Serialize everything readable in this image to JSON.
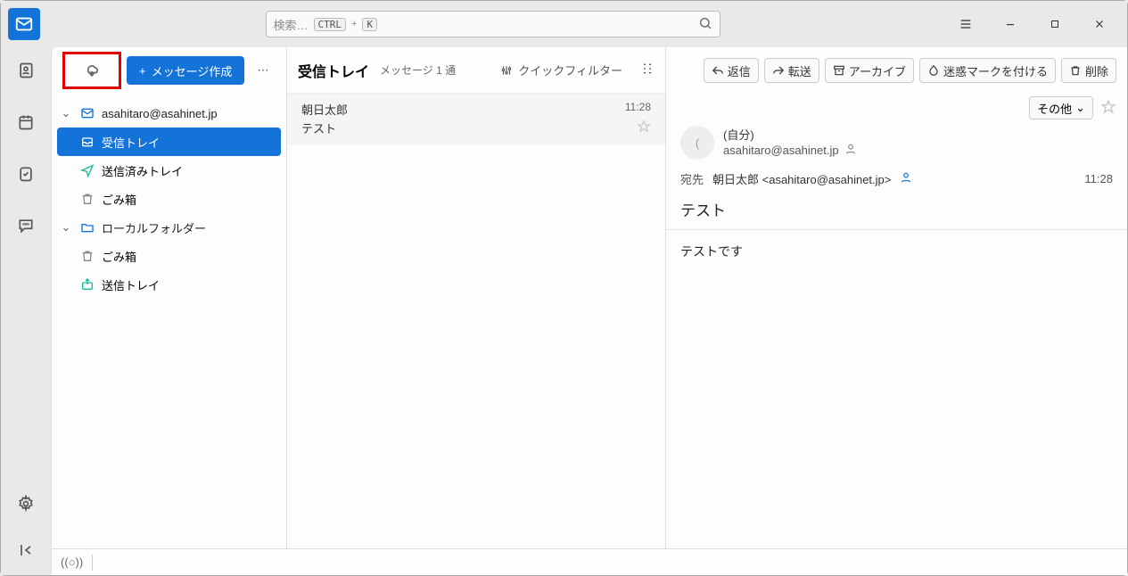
{
  "search": {
    "placeholder": "検索…",
    "kbd1": "CTRL",
    "plus": "+",
    "kbd2": "K"
  },
  "folder_toolbar": {
    "compose": "メッセージ作成"
  },
  "accounts": [
    {
      "name": "asahitaro@asahinet.jp",
      "folders": [
        {
          "label": "受信トレイ",
          "icon": "inbox",
          "selected": true
        },
        {
          "label": "送信済みトレイ",
          "icon": "sent"
        },
        {
          "label": "ごみ箱",
          "icon": "trash"
        }
      ]
    },
    {
      "name": "ローカルフォルダー",
      "folders": [
        {
          "label": "ごみ箱",
          "icon": "trash"
        },
        {
          "label": "送信トレイ",
          "icon": "outbox"
        }
      ]
    }
  ],
  "list": {
    "title": "受信トレイ",
    "count": "メッセージ 1 通",
    "quickfilter": "クイックフィルター",
    "messages": [
      {
        "sender": "朝日太郎",
        "time": "11:28",
        "subject": "テスト"
      }
    ]
  },
  "read_toolbar": {
    "reply": "返信",
    "forward": "転送",
    "archive": "アーカイブ",
    "junk": "迷惑マークを付ける",
    "delete": "削除",
    "other": "その他"
  },
  "message": {
    "sender_name": "(自分)",
    "sender_email": "asahitaro@asahinet.jp",
    "recipient_label": "宛先",
    "recipient": "朝日太郎 <asahitaro@asahinet.jp>",
    "time": "11:28",
    "subject": "テスト",
    "body": "テストです"
  },
  "avatar_initial": "("
}
